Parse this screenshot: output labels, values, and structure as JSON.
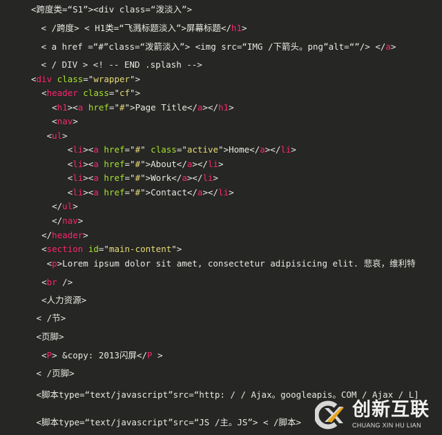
{
  "code_lines": [
    {
      "indent": "",
      "segments": [
        {
          "t": "txt",
          "v": "<跨度类=“S1”><div class=“泼淡入”>"
        }
      ]
    },
    {
      "indent": " ",
      "segments": [
        {
          "t": "txt",
          "v": "< /跨度> < H1类=“飞溅标题淡入”>屏幕标题</"
        },
        {
          "t": "tag",
          "v": "h1"
        },
        {
          "t": "txt",
          "v": ">"
        }
      ]
    },
    {
      "indent": " ",
      "segments": [
        {
          "t": "txt",
          "v": "< a href =“#”class=“泼箭淡入”> <img src=“IMG /下箭头。png”alt=“”/> </"
        },
        {
          "t": "tag",
          "v": "a"
        },
        {
          "t": "txt",
          "v": ">"
        }
      ]
    },
    {
      "indent": " ",
      "segments": [
        {
          "t": "txt",
          "v": "< / DIV > <! -- END .splash -->"
        }
      ]
    },
    {
      "indent": "",
      "segments": [
        {
          "t": "txt",
          "v": "<"
        },
        {
          "t": "tag",
          "v": "div"
        },
        {
          "t": "txt",
          "v": " "
        },
        {
          "t": "attr",
          "v": "class"
        },
        {
          "t": "txt",
          "v": "=\""
        },
        {
          "t": "str",
          "v": "wrapper"
        },
        {
          "t": "txt",
          "v": "\">"
        }
      ]
    },
    {
      "indent": "  ",
      "segments": [
        {
          "t": "txt",
          "v": "<"
        },
        {
          "t": "tag",
          "v": "header"
        },
        {
          "t": "txt",
          "v": " "
        },
        {
          "t": "attr",
          "v": "class"
        },
        {
          "t": "txt",
          "v": "=\""
        },
        {
          "t": "str",
          "v": "cf"
        },
        {
          "t": "txt",
          "v": "\">"
        }
      ]
    },
    {
      "indent": "    ",
      "segments": [
        {
          "t": "txt",
          "v": "<"
        },
        {
          "t": "tag",
          "v": "h1"
        },
        {
          "t": "txt",
          "v": "><"
        },
        {
          "t": "tag",
          "v": "a"
        },
        {
          "t": "txt",
          "v": " "
        },
        {
          "t": "attr",
          "v": "href"
        },
        {
          "t": "txt",
          "v": "=\""
        },
        {
          "t": "str",
          "v": "#"
        },
        {
          "t": "txt",
          "v": "\">Page Title</"
        },
        {
          "t": "tag",
          "v": "a"
        },
        {
          "t": "txt",
          "v": "></"
        },
        {
          "t": "tag",
          "v": "h1"
        },
        {
          "t": "txt",
          "v": ">"
        }
      ]
    },
    {
      "indent": "    ",
      "segments": [
        {
          "t": "txt",
          "v": "<"
        },
        {
          "t": "tag",
          "v": "nav"
        },
        {
          "t": "txt",
          "v": ">"
        }
      ]
    },
    {
      "indent": "   ",
      "segments": [
        {
          "t": "txt",
          "v": "<"
        },
        {
          "t": "tag",
          "v": "ul"
        },
        {
          "t": "txt",
          "v": ">"
        }
      ]
    },
    {
      "indent": "       ",
      "segments": [
        {
          "t": "txt",
          "v": "<"
        },
        {
          "t": "tag",
          "v": "li"
        },
        {
          "t": "txt",
          "v": "><"
        },
        {
          "t": "tag",
          "v": "a"
        },
        {
          "t": "txt",
          "v": " "
        },
        {
          "t": "attr",
          "v": "href"
        },
        {
          "t": "txt",
          "v": "=\""
        },
        {
          "t": "str",
          "v": "#"
        },
        {
          "t": "txt",
          "v": "\" "
        },
        {
          "t": "attr",
          "v": "class"
        },
        {
          "t": "txt",
          "v": "=\""
        },
        {
          "t": "str",
          "v": "active"
        },
        {
          "t": "txt",
          "v": "\">Home</"
        },
        {
          "t": "tag",
          "v": "a"
        },
        {
          "t": "txt",
          "v": "></"
        },
        {
          "t": "tag",
          "v": "li"
        },
        {
          "t": "txt",
          "v": ">"
        }
      ]
    },
    {
      "indent": "       ",
      "segments": [
        {
          "t": "txt",
          "v": "<"
        },
        {
          "t": "tag",
          "v": "li"
        },
        {
          "t": "txt",
          "v": "><"
        },
        {
          "t": "tag",
          "v": "a"
        },
        {
          "t": "txt",
          "v": " "
        },
        {
          "t": "attr",
          "v": "href"
        },
        {
          "t": "txt",
          "v": "=\""
        },
        {
          "t": "str",
          "v": "#"
        },
        {
          "t": "txt",
          "v": "\">About</"
        },
        {
          "t": "tag",
          "v": "a"
        },
        {
          "t": "txt",
          "v": "></"
        },
        {
          "t": "tag",
          "v": "li"
        },
        {
          "t": "txt",
          "v": ">"
        }
      ]
    },
    {
      "indent": "       ",
      "segments": [
        {
          "t": "txt",
          "v": "<"
        },
        {
          "t": "tag",
          "v": "li"
        },
        {
          "t": "txt",
          "v": "><"
        },
        {
          "t": "tag",
          "v": "a"
        },
        {
          "t": "txt",
          "v": " "
        },
        {
          "t": "attr",
          "v": "href"
        },
        {
          "t": "txt",
          "v": "=\""
        },
        {
          "t": "str",
          "v": "#"
        },
        {
          "t": "txt",
          "v": "\">Work</"
        },
        {
          "t": "tag",
          "v": "a"
        },
        {
          "t": "txt",
          "v": "></"
        },
        {
          "t": "tag",
          "v": "li"
        },
        {
          "t": "txt",
          "v": ">"
        }
      ]
    },
    {
      "indent": "       ",
      "segments": [
        {
          "t": "txt",
          "v": "<"
        },
        {
          "t": "tag",
          "v": "li"
        },
        {
          "t": "txt",
          "v": "><"
        },
        {
          "t": "tag",
          "v": "a"
        },
        {
          "t": "txt",
          "v": " "
        },
        {
          "t": "attr",
          "v": "href"
        },
        {
          "t": "txt",
          "v": "=\""
        },
        {
          "t": "str",
          "v": "#"
        },
        {
          "t": "txt",
          "v": "\">Contact</"
        },
        {
          "t": "tag",
          "v": "a"
        },
        {
          "t": "txt",
          "v": "></"
        },
        {
          "t": "tag",
          "v": "li"
        },
        {
          "t": "txt",
          "v": ">"
        }
      ]
    },
    {
      "indent": "    ",
      "segments": [
        {
          "t": "txt",
          "v": "</"
        },
        {
          "t": "tag",
          "v": "ul"
        },
        {
          "t": "txt",
          "v": ">"
        }
      ]
    },
    {
      "indent": "    ",
      "segments": [
        {
          "t": "txt",
          "v": "</"
        },
        {
          "t": "tag",
          "v": "nav"
        },
        {
          "t": "txt",
          "v": ">"
        }
      ]
    },
    {
      "indent": "  ",
      "segments": [
        {
          "t": "txt",
          "v": "</"
        },
        {
          "t": "tag",
          "v": "header"
        },
        {
          "t": "txt",
          "v": ">"
        }
      ]
    },
    {
      "indent": "  ",
      "segments": [
        {
          "t": "txt",
          "v": "<"
        },
        {
          "t": "tag",
          "v": "section"
        },
        {
          "t": "txt",
          "v": " "
        },
        {
          "t": "attr",
          "v": "id"
        },
        {
          "t": "txt",
          "v": "=\""
        },
        {
          "t": "str",
          "v": "main-content"
        },
        {
          "t": "txt",
          "v": "\">"
        }
      ]
    },
    {
      "indent": "   ",
      "segments": [
        {
          "t": "txt",
          "v": "<"
        },
        {
          "t": "tag",
          "v": "p"
        },
        {
          "t": "txt",
          "v": ">Lorem ipsum dolor sit amet, consectetur adipisicing elit. 悲哀，维利特"
        }
      ]
    },
    {
      "indent": "  ",
      "segments": [
        {
          "t": "txt",
          "v": "<"
        },
        {
          "t": "tag",
          "v": "br"
        },
        {
          "t": "txt",
          "v": " />"
        }
      ]
    },
    {
      "indent": "  ",
      "segments": [
        {
          "t": "txt",
          "v": "<人力资源>"
        }
      ]
    },
    {
      "indent": " ",
      "segments": [
        {
          "t": "txt",
          "v": "< /节>"
        }
      ]
    },
    {
      "indent": " ",
      "segments": [
        {
          "t": "txt",
          "v": "<页脚>"
        }
      ]
    },
    {
      "indent": "  ",
      "segments": [
        {
          "t": "txt",
          "v": "<"
        },
        {
          "t": "tag",
          "v": "P"
        },
        {
          "t": "txt",
          "v": "> &copy: 2013闪屏</"
        },
        {
          "t": "tag",
          "v": "P"
        },
        {
          "t": "txt",
          "v": " >"
        }
      ]
    },
    {
      "indent": " ",
      "segments": [
        {
          "t": "txt",
          "v": "< /页脚>"
        }
      ]
    },
    {
      "indent": " ",
      "segments": [
        {
          "t": "txt",
          "v": "<脚本type=“text/javascript”src=“http: / / Ajax。googleapis。COM / Ajax / L]"
        }
      ]
    },
    {
      "indent": " ",
      "segments": [
        {
          "t": "txt",
          "v": "<脚本type=“text/javascript”src=“JS /主。JS”> < /脚本>"
        }
      ]
    }
  ],
  "watermark": {
    "icon": "cx-logo-icon",
    "title_cn": "创新互联",
    "title_en": "CHUANG XIN HU LIAN",
    "colors": {
      "ring": "#d8d8d8",
      "accent": "#e8a417"
    }
  },
  "theme": {
    "background": "#262624",
    "text": "#e8e8e2",
    "tag": "#f92672",
    "attr": "#a6e22e",
    "string": "#e6db74"
  }
}
